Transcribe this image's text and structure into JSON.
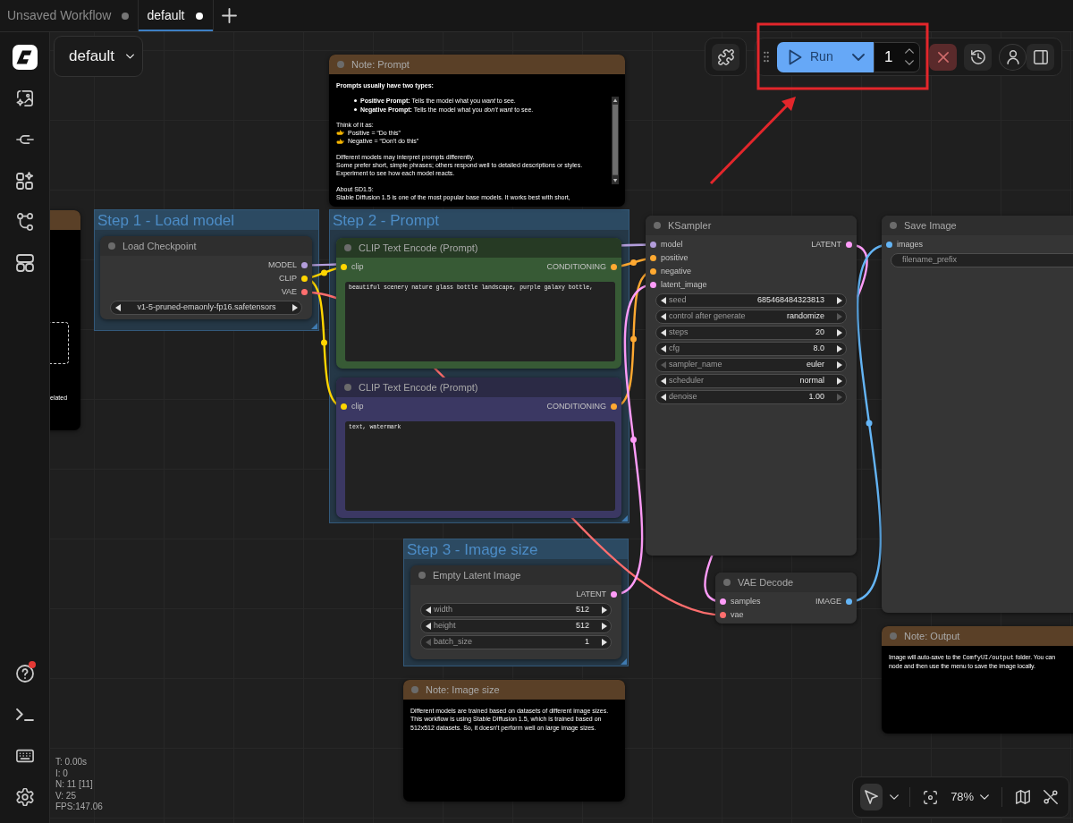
{
  "tabs": [
    {
      "label": "Unsaved Workflow",
      "selected": false,
      "modified": true
    },
    {
      "label": "default",
      "selected": true,
      "modified": true
    }
  ],
  "workflow_menu": {
    "label": "default"
  },
  "sidebar": {
    "top": [
      {
        "kind": "logo"
      },
      {
        "kind": "images"
      },
      {
        "kind": "models"
      },
      {
        "kind": "nodes"
      },
      {
        "kind": "workflows"
      },
      {
        "kind": "templates"
      }
    ],
    "bottom": [
      {
        "kind": "help",
        "badge": true
      },
      {
        "kind": "console",
        "badge": false
      },
      {
        "kind": "shortcuts",
        "badge": false
      },
      {
        "kind": "settings",
        "badge": false
      }
    ]
  },
  "actionbar": {
    "run_label": "Run",
    "batch_count": "1"
  },
  "groups": [
    {
      "title": "Step 1 - Load model"
    },
    {
      "title": "Step 2 - Prompt"
    },
    {
      "title": "Step 3 - Image size"
    }
  ],
  "nodes": [
    {
      "kind": "note",
      "header": {
        "color": "#5a4027"
      },
      "color": "#000000",
      "body": [
        {
          "lines": [
            {
              "kind": "frame"
            }
          ]
        },
        {
          "lines": [
            {
              "kind": "plain",
              "text": "elated"
            }
          ]
        }
      ]
    },
    {
      "kind": "note",
      "title": "Note: Prompt",
      "header": {
        "color": "#5a4027"
      },
      "color": "#000000",
      "scrollbar": true,
      "body": [
        {
          "lines": [
            {
              "kind": "bold",
              "text": "Prompts usually have two types:"
            }
          ]
        },
        {
          "lines": [
            {
              "kind": "bullet",
              "text": "**Positive Prompt:** Tells the model what you *want* to see."
            },
            {
              "kind": "bullet",
              "text": "**Negative Prompt:** Tells the model what you *don’t want* to see."
            }
          ]
        },
        {
          "lines": [
            {
              "kind": "plain",
              "text": "Think of it as:"
            },
            {
              "kind": "pointer",
              "text": "Positive = “Do this”"
            },
            {
              "kind": "pointer",
              "text": "Negative = “Don’t do this”"
            }
          ]
        },
        {
          "lines": [
            {
              "kind": "plain",
              "text": "Different models may interpret prompts differently."
            },
            {
              "kind": "plain",
              "text": "Some prefer short, simple phrases; others respond well to detailed descriptions or styles. Experiment to see how each model reacts."
            }
          ]
        },
        {
          "lines": [
            {
              "kind": "plain",
              "text": "About SD1.5:"
            },
            {
              "kind": "plain",
              "text": "Stable Diffusion 1.5 is one of the most popular base models. It works best with short,"
            }
          ]
        }
      ]
    },
    {
      "kind": "node",
      "title": "Load Checkpoint",
      "header": {
        "color": "#2e2e2e"
      },
      "color": "#353535",
      "outputs": [
        {
          "name": "MODEL",
          "color": "#b39ddb"
        },
        {
          "name": "CLIP",
          "color": "#ffd500"
        },
        {
          "name": "VAE",
          "color": "#ff6e6e"
        }
      ],
      "widgets": [
        {
          "kind": "combo",
          "value": "v1-5-pruned-emaonly-fp16.safetensors",
          "prev_disabled": false,
          "next_disabled": false
        }
      ]
    },
    {
      "kind": "node",
      "title": "CLIP Text Encode (Prompt)",
      "header": {
        "color": "#263a24"
      },
      "color": "#375a35",
      "inputs": [
        {
          "name": "clip",
          "color": "#ffd500"
        }
      ],
      "outputs": [
        {
          "name": "CONDITIONING",
          "color": "#ffa931"
        }
      ],
      "widgets": [
        {
          "kind": "textarea",
          "value": "beautiful scenery nature glass bottle landscape, purple galaxy bottle,"
        }
      ]
    },
    {
      "kind": "node",
      "title": "CLIP Text Encode (Prompt)",
      "header": {
        "color": "#2b2a45"
      },
      "color": "#3b3863",
      "inputs": [
        {
          "name": "clip",
          "color": "#ffd500"
        }
      ],
      "outputs": [
        {
          "name": "CONDITIONING",
          "color": "#ffa931"
        }
      ],
      "widgets": [
        {
          "kind": "textarea",
          "value": "text, watermark"
        }
      ]
    },
    {
      "kind": "node",
      "title": "KSampler",
      "header": {
        "color": "#2e2e2e"
      },
      "color": "#353535",
      "inputs": [
        {
          "name": "model",
          "color": "#b39ddb"
        },
        {
          "name": "positive",
          "color": "#ffa931"
        },
        {
          "name": "negative",
          "color": "#ffa931"
        },
        {
          "name": "latent_image",
          "color": "#ff9cf9"
        }
      ],
      "outputs": [
        {
          "name": "LATENT",
          "color": "#ff9cf9"
        }
      ],
      "widgets": [
        {
          "kind": "number",
          "label": "seed",
          "value": "685468484323813",
          "prev_disabled": false,
          "next_disabled": false
        },
        {
          "kind": "combo",
          "label": "control after generate",
          "value": "randomize",
          "prev_disabled": false,
          "next_disabled": true
        },
        {
          "kind": "number",
          "label": "steps",
          "value": "20",
          "prev_disabled": false,
          "next_disabled": false
        },
        {
          "kind": "number",
          "label": "cfg",
          "value": "8.0",
          "prev_disabled": false,
          "next_disabled": false
        },
        {
          "kind": "combo",
          "label": "sampler_name",
          "value": "euler",
          "prev_disabled": true,
          "next_disabled": false
        },
        {
          "kind": "combo",
          "label": "scheduler",
          "value": "normal",
          "prev_disabled": false,
          "next_disabled": false
        },
        {
          "kind": "number",
          "label": "denoise",
          "value": "1.00",
          "prev_disabled": false,
          "next_disabled": true
        }
      ]
    },
    {
      "kind": "node",
      "title": "Save Image",
      "header": {
        "color": "#2e2e2e"
      },
      "color": "#353535",
      "inputs": [
        {
          "name": "images",
          "color": "#64b5f6"
        }
      ],
      "widgets": [
        {
          "kind": "text",
          "label": "filename_prefix"
        }
      ]
    },
    {
      "kind": "node",
      "title": "VAE Decode",
      "header": {
        "color": "#2e2e2e"
      },
      "color": "#353535",
      "inputs": [
        {
          "name": "samples",
          "color": "#ff9cf9"
        },
        {
          "name": "vae",
          "color": "#ff6e6e"
        }
      ],
      "outputs": [
        {
          "name": "IMAGE",
          "color": "#64b5f6"
        }
      ]
    },
    {
      "kind": "node",
      "title": "Empty Latent Image",
      "header": {
        "color": "#2e2e2e"
      },
      "color": "#353535",
      "outputs": [
        {
          "name": "LATENT",
          "color": "#ff9cf9"
        }
      ],
      "widgets": [
        {
          "kind": "number",
          "label": "width",
          "value": "512",
          "prev_disabled": false,
          "next_disabled": false
        },
        {
          "kind": "number",
          "label": "height",
          "value": "512",
          "prev_disabled": false,
          "next_disabled": false
        },
        {
          "kind": "number",
          "label": "batch_size",
          "value": "1",
          "prev_disabled": true,
          "next_disabled": false
        }
      ]
    },
    {
      "kind": "note",
      "title": "Note: Image size",
      "header": {
        "color": "#5a4027"
      },
      "color": "#000000",
      "body": [
        {
          "lines": [
            {
              "kind": "plain",
              "text": "Different models are trained based on datasets of different image sizes. This workflow is using Stable Diffusion 1.5, which is trained based on 512x512 datasets. So, it doesn't perform well on large image sizes."
            }
          ]
        }
      ]
    },
    {
      "kind": "note",
      "title": "Note: Output",
      "header": {
        "color": "#5a4027"
      },
      "color": "#000000",
      "body": [
        {
          "lines": [
            {
              "kind": "plain",
              "segments": [
                {
                  "text": "Image will auto-save to the "
                },
                {
                  "kind": "code",
                  "text": "ComfyUI/output"
                },
                {
                  "text": " folder. You can"
                }
              ]
            },
            {
              "kind": "plain",
              "text": "node and then use the menu to save the image locally."
            }
          ]
        }
      ]
    }
  ],
  "stats": [
    "T: 0.00s",
    "I: 0",
    "N: 11 [11]",
    "V: 25",
    "FPS:147.06"
  ],
  "canvas_toolbar": {
    "select_active": true,
    "zoom": "78%"
  },
  "annotations": {
    "highlight_frame": true,
    "arrow": true
  }
}
